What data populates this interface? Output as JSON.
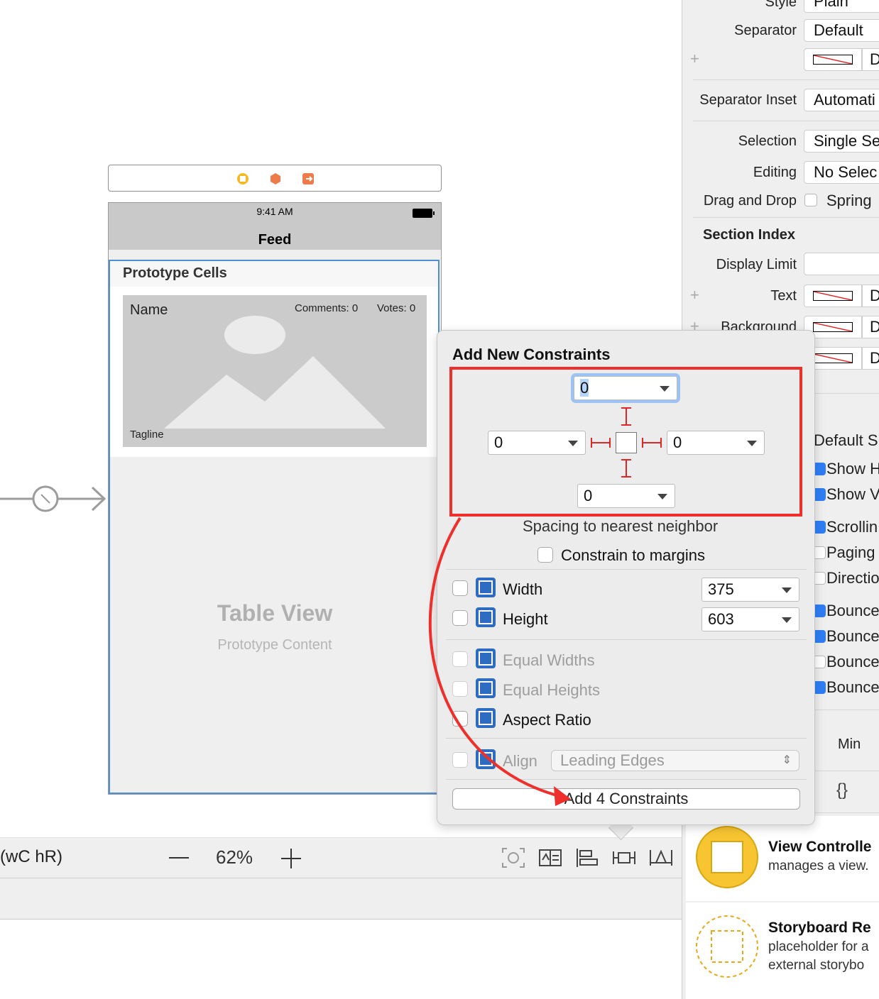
{
  "scene": {
    "status_time": "9:41 AM",
    "nav_title": "Feed",
    "prototype_cells_label": "Prototype Cells",
    "cell": {
      "name": "Name",
      "comments": "Comments: 0",
      "votes": "Votes: 0",
      "tagline": "Tagline"
    },
    "table_view_title": "Table View",
    "table_view_subtitle": "Prototype Content"
  },
  "canvas_toolbar": {
    "size_class": "(wC hR)",
    "zoom_level": "62%",
    "icons": [
      "update-frames-icon",
      "embed-in-stack-icon",
      "align-icon",
      "add-constraints-icon",
      "resolve-issues-icon"
    ]
  },
  "inspector": {
    "style_label": "Style",
    "style_value": "Plain",
    "separator_label": "Separator",
    "separator_value": "Default",
    "separator_color_value": "D",
    "separator_inset_label": "Separator Inset",
    "separator_inset_value": "Automati",
    "selection_label": "Selection",
    "selection_value": "Single Se",
    "editing_label": "Editing",
    "editing_value": "No Selec",
    "drag_drop_label": "Drag and Drop",
    "drag_drop_option": "Spring",
    "section_index_header": "Section Index",
    "display_limit_label": "Display Limit",
    "text_label": "Text",
    "text_value": "D",
    "background_label": "Background",
    "background_value": "D",
    "extra_value": "D",
    "default_s": "Default S",
    "checks": [
      "Show H",
      "Show V",
      "Scrollin",
      "Paging",
      "Directio",
      "Bounce",
      "Bounce",
      "Bounce",
      "Bounce"
    ],
    "min_label": "Min",
    "library": [
      {
        "title": "View Controlle",
        "desc": [
          "manages a view."
        ]
      },
      {
        "title": "Storyboard Re",
        "desc": [
          "placeholder for a",
          "external storybo"
        ]
      }
    ]
  },
  "popover": {
    "title": "Add New Constraints",
    "top_value": "0",
    "left_value": "0",
    "right_value": "0",
    "bottom_value": "0",
    "spacing_label": "Spacing to nearest neighbor",
    "margins_label": "Constrain to margins",
    "width_label": "Width",
    "width_value": "375",
    "height_label": "Height",
    "height_value": "603",
    "equal_widths_label": "Equal Widths",
    "equal_heights_label": "Equal Heights",
    "aspect_ratio_label": "Aspect Ratio",
    "align_label": "Align",
    "align_value": "Leading Edges",
    "add_button": "Add 4 Constraints"
  },
  "colors": {
    "annotation_red": "#ee2f2b",
    "selection_blue": "#4f8fd6",
    "constraint_icon_blue": "#2d6cc0",
    "library_yellow": "#f7c531"
  }
}
